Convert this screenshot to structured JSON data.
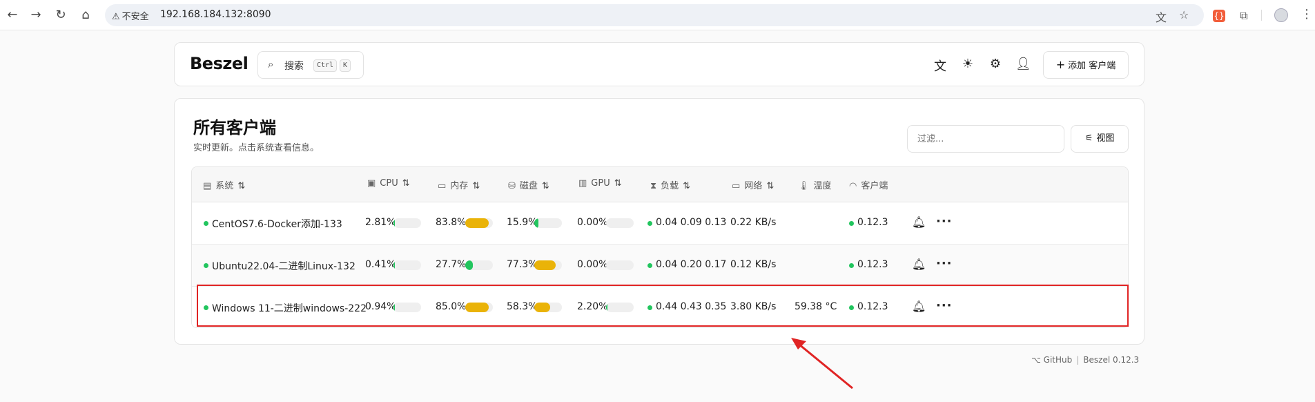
{
  "browser": {
    "insecure_label": "不安全",
    "url": "192.168.184.132:8090"
  },
  "header": {
    "logo": "Beszel",
    "search_label": "搜索",
    "kbd_ctrl": "Ctrl",
    "kbd_k": "K",
    "add_client_label": "添加 客户端"
  },
  "main": {
    "title": "所有客户端",
    "subtitle": "实时更新。点击系统查看信息。",
    "filter_placeholder": "过滤...",
    "view_label": "视图"
  },
  "table": {
    "columns": {
      "system": "系统",
      "cpu": "CPU",
      "memory": "内存",
      "disk": "磁盘",
      "gpu": "GPU",
      "load": "负载",
      "network": "网络",
      "temperature": "温度",
      "agent": "客户端"
    },
    "rows": [
      {
        "name": "CentOS7.6-Docker添加-133",
        "cpu": "2.81%",
        "cpu_pct": 2.81,
        "memory": "83.8%",
        "memory_pct": 83.8,
        "disk": "15.9%",
        "disk_pct": 15.9,
        "gpu": "0.00%",
        "gpu_pct": 0,
        "load": "0.04 0.09 0.13",
        "network": "0.22 KB/s",
        "temperature": "",
        "agent": "0.12.3"
      },
      {
        "name": "Ubuntu22.04-二进制Linux-132",
        "cpu": "0.41%",
        "cpu_pct": 0.41,
        "memory": "27.7%",
        "memory_pct": 27.7,
        "disk": "77.3%",
        "disk_pct": 77.3,
        "gpu": "0.00%",
        "gpu_pct": 0,
        "load": "0.04 0.20 0.17",
        "network": "0.12 KB/s",
        "temperature": "",
        "agent": "0.12.3"
      },
      {
        "name": "Windows 11-二进制windows-222",
        "cpu": "0.94%",
        "cpu_pct": 0.94,
        "memory": "85.0%",
        "memory_pct": 85.0,
        "disk": "58.3%",
        "disk_pct": 58.3,
        "gpu": "2.20%",
        "gpu_pct": 2.2,
        "load": "0.44 0.43 0.35",
        "network": "3.80 KB/s",
        "temperature": "59.38 °C",
        "agent": "0.12.3"
      }
    ]
  },
  "footer": {
    "github": "GitHub",
    "version": "Beszel 0.12.3"
  },
  "colors": {
    "status_green": "#22c55e",
    "bar_yellow": "#eab308",
    "bar_green": "#22c55e",
    "highlight_red": "#e02424"
  }
}
